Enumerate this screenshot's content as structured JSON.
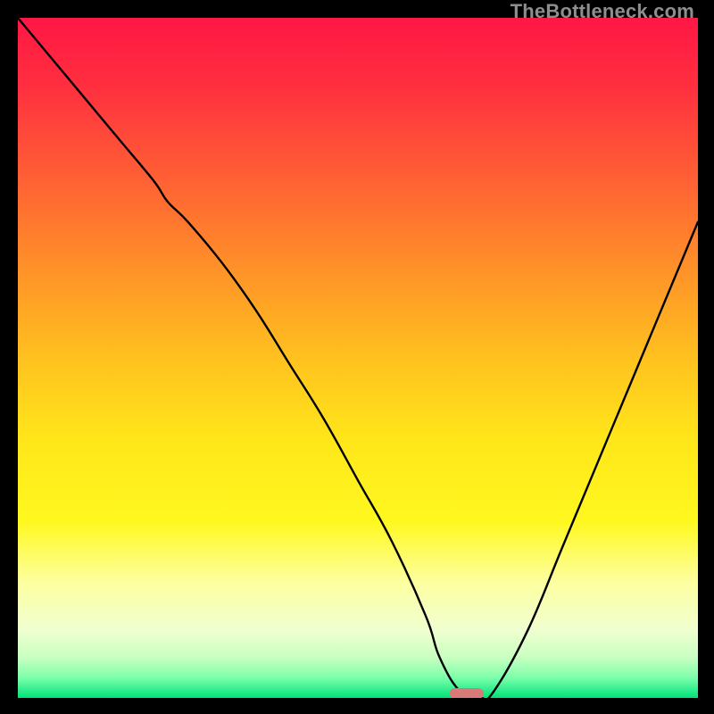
{
  "watermark": "TheBottleneck.com",
  "chart_data": {
    "type": "line",
    "title": "",
    "xlabel": "",
    "ylabel": "",
    "xlim": [
      0,
      100
    ],
    "ylim": [
      0,
      100
    ],
    "x": [
      0,
      5,
      10,
      15,
      20,
      22,
      25,
      30,
      35,
      40,
      45,
      50,
      55,
      60,
      62,
      65,
      68,
      70,
      75,
      80,
      85,
      90,
      95,
      100
    ],
    "values": [
      100,
      94,
      88,
      82,
      76,
      73,
      70,
      64,
      57,
      49,
      41,
      32,
      23,
      12,
      6,
      1,
      0,
      1,
      10,
      22,
      34,
      46,
      58,
      70
    ],
    "marker": {
      "x_center": 66,
      "width": 5,
      "color": "#d67b79"
    },
    "gradient_stops": [
      {
        "offset": 0.0,
        "color": "#ff1744"
      },
      {
        "offset": 0.1,
        "color": "#ff2f3f"
      },
      {
        "offset": 0.22,
        "color": "#ff5a36"
      },
      {
        "offset": 0.35,
        "color": "#ff8a2a"
      },
      {
        "offset": 0.5,
        "color": "#ffc11f"
      },
      {
        "offset": 0.62,
        "color": "#ffe61a"
      },
      {
        "offset": 0.74,
        "color": "#fff81f"
      },
      {
        "offset": 0.83,
        "color": "#fdffa0"
      },
      {
        "offset": 0.9,
        "color": "#f0ffd0"
      },
      {
        "offset": 0.94,
        "color": "#c9ffc0"
      },
      {
        "offset": 0.97,
        "color": "#7dffab"
      },
      {
        "offset": 1.0,
        "color": "#00e37a"
      }
    ]
  }
}
